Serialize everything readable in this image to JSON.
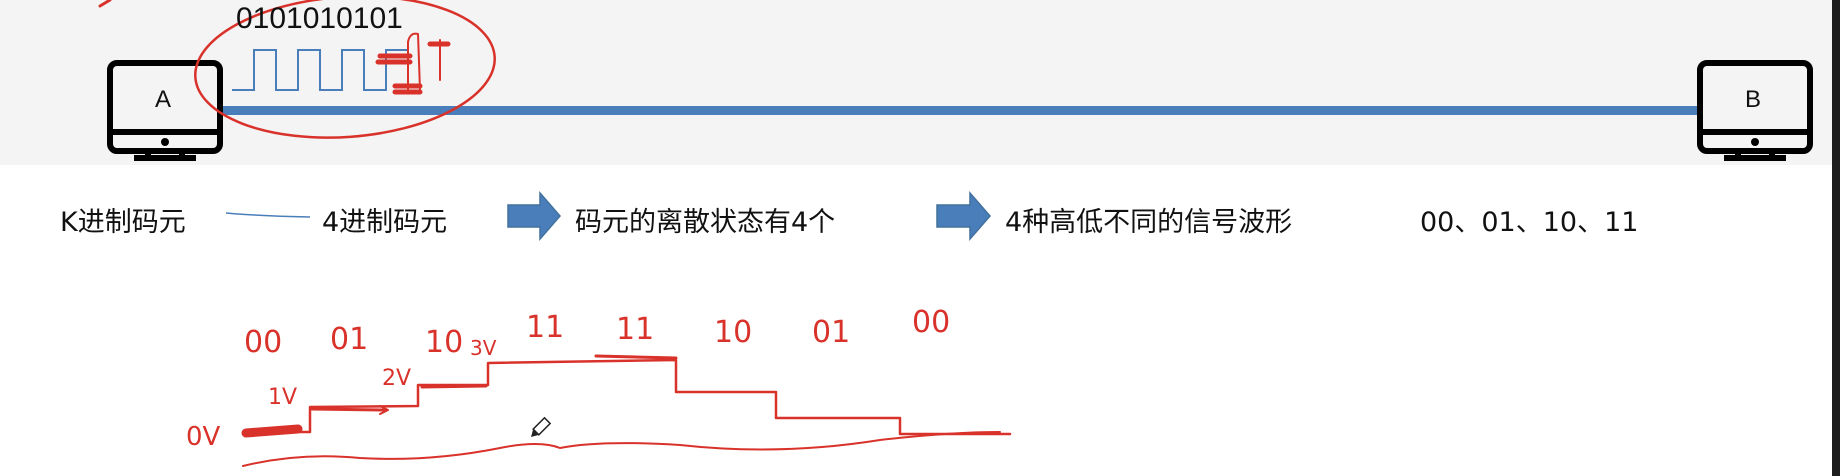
{
  "signal_bits": "0101010101",
  "computer_a_label": "A",
  "computer_b_label": "B",
  "flow": {
    "k_ary": "K进制码元",
    "four_ary": "4进制码元",
    "discrete_states": "码元的离散状态有4个",
    "four_waveforms": "4种高低不同的信号波形",
    "codes": "00、01、10、11"
  },
  "handwritten": {
    "codes": [
      "00",
      "01",
      "10",
      "11",
      "11",
      "10",
      "01",
      "00"
    ],
    "voltages": [
      "0V",
      "1V",
      "2V",
      "3V"
    ]
  },
  "colors": {
    "line": "#4a7ebb",
    "arrow": "#4a7ebb",
    "ink": "#d9322b",
    "text": "#111111"
  }
}
